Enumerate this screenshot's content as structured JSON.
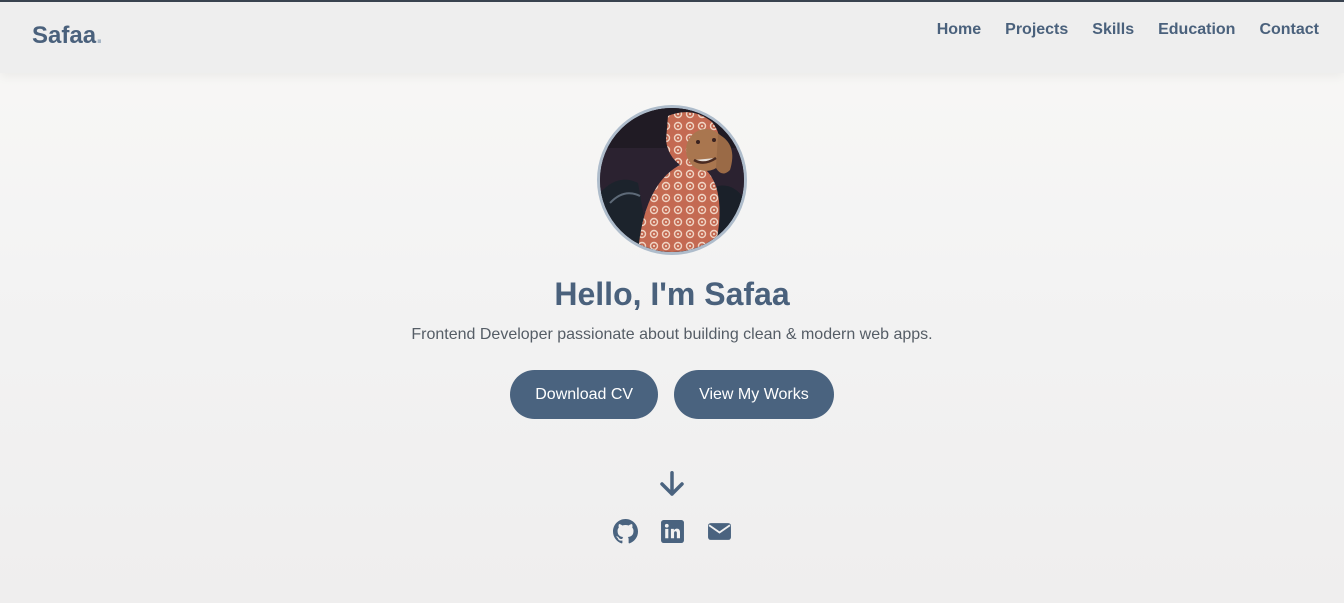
{
  "colors": {
    "primary": "#4a637f",
    "text": "#4a617c",
    "muted": "#555d66",
    "nav_bg": "#eeeeee"
  },
  "nav": {
    "logo": "Safaa",
    "logo_dot": ".",
    "links": [
      "Home",
      "Projects",
      "Skills",
      "Education",
      "Contact"
    ]
  },
  "hero": {
    "title": "Hello, I'm Safaa",
    "subtitle": "Frontend Developer passionate about building clean & modern web apps.",
    "buttons": {
      "download": "Download CV",
      "works": "View My Works"
    }
  },
  "icons": {
    "scroll": "arrow-down-icon",
    "socials": [
      "github-icon",
      "linkedin-icon",
      "mail-icon"
    ]
  }
}
